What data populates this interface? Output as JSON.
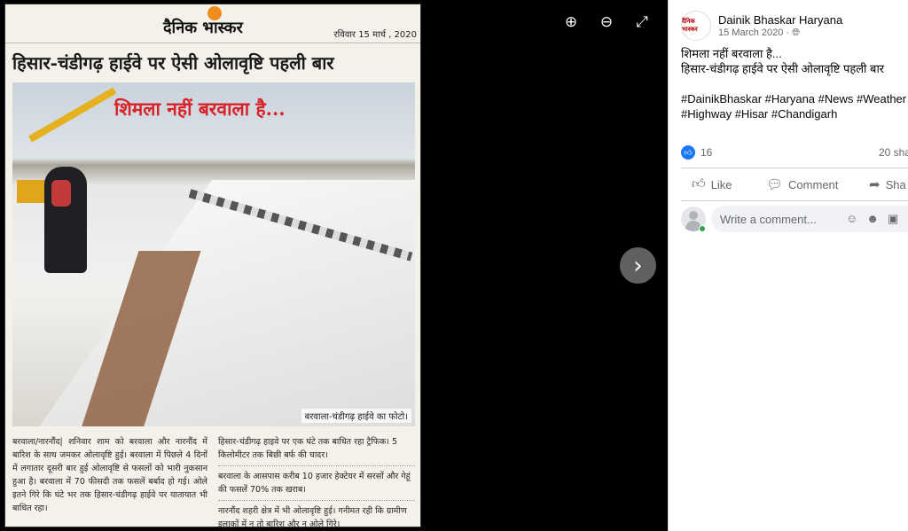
{
  "viewer": {
    "newspaper": {
      "logo": "दैनिक भास्कर",
      "dateline": "रविवार 15 मार्च , 2020",
      "headline": "हिसार-चंडीगढ़ हाईवे पर ऐसी ओलावृष्टि पहली बार",
      "photo_title": "शिमला नहीं बरवाला है...",
      "photo_caption": "बरवाला-चंडीगढ़ हाईवे का फोटो।",
      "body_left": "बरवाला/नारनौंद| शनिवार शाम को बरवाला और नारनौंद में बारिश के साथ जमकर ओलावृष्टि हुई। बरवाला में पिछले 4 दिनों में लगातार दूसरी बार हुई ओलावृष्टि से फसलों को भारी नुकसान हुआ है। बरवाला में 70 फीसदी तक फसलें बर्बाद हो गई। ओले इतने गिरे कि घंटे भर तक हिसार-चंडीगढ़ हाईवे पर यातायात भी बाधित रहा।",
      "points": [
        "हिसार-चंडीगढ़ हाइवे पर एक घंटे तक बाधित रहा ट्रैफिक। 5 किलोमीटर तक बिछी बर्फ की चादर।",
        "बरवाला के आसपास करीब 10 हजार हेक्टेयर में सरसों और गेहूं की फसलें 70% तक खराब।",
        "नारनौंद शहरी क्षेत्र में भी ओलावृष्टि हुई। गनीमत रही कि ग्रामीण इलाकों में न तो बारिश और न ओले गिरे।"
      ]
    },
    "tools": {
      "zoom_in": "⊕",
      "zoom_out": "⊖",
      "fullscreen": "⤢"
    },
    "next": "›"
  },
  "post": {
    "avatar_text": "दैनिक भास्कर",
    "author": "Dainik Bhaskar Haryana",
    "date": "15 March 2020 ·",
    "caption_line1": "शिमला नहीं बरवाला है...",
    "caption_line2": "हिसार-चंडीगढ़ हाईवे पर ऐसी ओलावृष्टि पहली बार",
    "hashtags_line1": "#DainikBhaskar #Haryana #News #Weather",
    "hashtags_line2": "#Highway #Hisar #Chandigarh",
    "like_count": "16",
    "shares": "20 sha",
    "actions": {
      "like": "Like",
      "comment": "Comment",
      "share": "Sha"
    },
    "comment_placeholder": "Write a comment..."
  }
}
